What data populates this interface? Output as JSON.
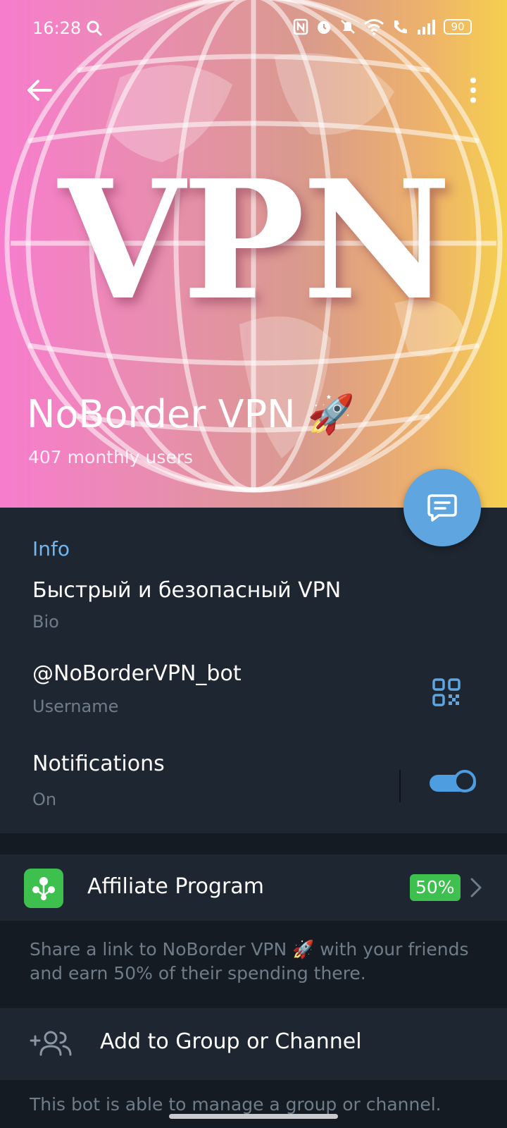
{
  "status_bar": {
    "time": "16:28",
    "battery": "90"
  },
  "hero": {
    "logo_text": "VPN",
    "bot_name": "NoBorder VPN 🚀",
    "monthly_users": "407 monthly users"
  },
  "info": {
    "section_title": "Info",
    "bio_value": "Быстрый и безопасный VPN",
    "bio_label": "Bio",
    "username_value": "@NoBorderVPN_bot",
    "username_label": "Username",
    "notifications_label": "Notifications",
    "notifications_state": "On",
    "notifications_on": true
  },
  "affiliate": {
    "label": "Affiliate Program",
    "badge": "50%",
    "description": "Share a link to NoBorder VPN 🚀 with your friends and earn 50% of their spending there."
  },
  "add_group": {
    "label": "Add to Group or Channel",
    "description_partial": "This bot is able to manage a group or channel."
  },
  "colors": {
    "accent": "#70b6f0",
    "fab": "#5fa5e0",
    "toggle": "#4d9de0",
    "badge_green": "#3ec04f",
    "panel_bg": "#1e2631"
  }
}
